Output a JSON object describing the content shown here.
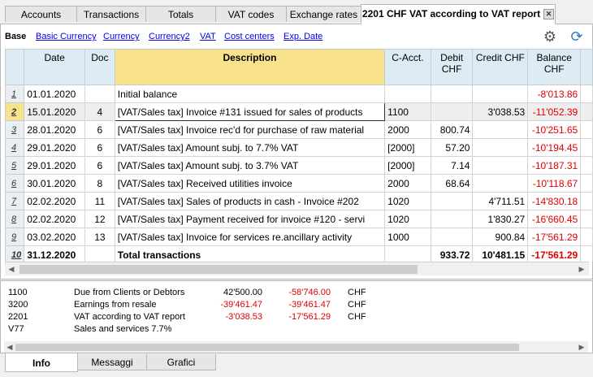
{
  "tabs": [
    {
      "label": "Accounts"
    },
    {
      "label": "Transactions"
    },
    {
      "label": "Totals"
    },
    {
      "label": "VAT codes"
    },
    {
      "label": "Exchange rates"
    },
    {
      "label": "2201 CHF VAT according to VAT report"
    }
  ],
  "views": {
    "base": "Base",
    "items": [
      "Basic Currency",
      "Currency",
      "Currency2",
      "VAT",
      "Cost centers",
      "Exp. Date"
    ]
  },
  "columns": {
    "date": "Date",
    "doc": "Doc",
    "description": "Description",
    "cacct": "C-Acct.",
    "debit": "Debit CHF",
    "credit": "Credit CHF",
    "balance": "Balance CHF"
  },
  "rows": [
    {
      "n": "1",
      "date": "01.01.2020",
      "doc": "",
      "desc": "Initial balance",
      "cacct": "",
      "debit": "",
      "credit": "",
      "balance": "-8'013.86"
    },
    {
      "n": "2",
      "date": "15.01.2020",
      "doc": "4",
      "desc": "[VAT/Sales tax] Invoice #131 issued for sales of products",
      "cacct": "1100",
      "debit": "",
      "credit": "3'038.53",
      "balance": "-11'052.39"
    },
    {
      "n": "3",
      "date": "28.01.2020",
      "doc": "6",
      "desc": "[VAT/Sales tax] Invoice rec'd for purchase of raw material",
      "cacct": "2000",
      "debit": "800.74",
      "credit": "",
      "balance": "-10'251.65"
    },
    {
      "n": "4",
      "date": "29.01.2020",
      "doc": "6",
      "desc": "[VAT/Sales tax] Amount subj. to 7.7% VAT",
      "cacct": "[2000]",
      "debit": "57.20",
      "credit": "",
      "balance": "-10'194.45"
    },
    {
      "n": "5",
      "date": "29.01.2020",
      "doc": "6",
      "desc": "[VAT/Sales tax] Amount subj. to 3.7% VAT",
      "cacct": "[2000]",
      "debit": "7.14",
      "credit": "",
      "balance": "-10'187.31"
    },
    {
      "n": "6",
      "date": "30.01.2020",
      "doc": "8",
      "desc": "[VAT/Sales tax] Received utilities invoice",
      "cacct": "2000",
      "debit": "68.64",
      "credit": "",
      "balance": "-10'118.67"
    },
    {
      "n": "7",
      "date": "02.02.2020",
      "doc": "11",
      "desc": "[VAT/Sales tax] Sales of products in cash - Invoice #202",
      "cacct": "1020",
      "debit": "",
      "credit": "4'711.51",
      "balance": "-14'830.18"
    },
    {
      "n": "8",
      "date": "02.02.2020",
      "doc": "12",
      "desc": "[VAT/Sales tax] Payment received for invoice #120 - servi",
      "cacct": "1020",
      "debit": "",
      "credit": "1'830.27",
      "balance": "-16'660.45"
    },
    {
      "n": "9",
      "date": "03.02.2020",
      "doc": "13",
      "desc": "[VAT/Sales tax] Invoice for services re.ancillary activity",
      "cacct": "1000",
      "debit": "",
      "credit": "900.84",
      "balance": "-17'561.29"
    }
  ],
  "total": {
    "n": "10",
    "date": "31.12.2020",
    "desc": "Total transactions",
    "debit": "933.72",
    "credit": "10'481.15",
    "balance": "-17'561.29"
  },
  "info": [
    {
      "acct": "1100",
      "desc": "Due from Clients or Debtors",
      "a": "42'500.00",
      "b": "-58'746.00",
      "cur": "CHF"
    },
    {
      "acct": "3200",
      "desc": "Earnings from resale",
      "a": "-39'461.47",
      "b": "-39'461.47",
      "cur": "CHF"
    },
    {
      "acct": "2201",
      "desc": "VAT according to VAT report",
      "a": "-3'038.53",
      "b": "-17'561.29",
      "cur": "CHF"
    },
    {
      "acct": "V77",
      "desc": "Sales and services 7.7%",
      "a": "",
      "b": "",
      "cur": ""
    }
  ],
  "bottom_tabs": [
    {
      "label": "Info"
    },
    {
      "label": "Messaggi"
    },
    {
      "label": "Grafici"
    }
  ],
  "colors": {
    "negative": "#e00000",
    "link": "#0000ee",
    "header": "#dcebf4",
    "highlight": "#f9e28c"
  }
}
